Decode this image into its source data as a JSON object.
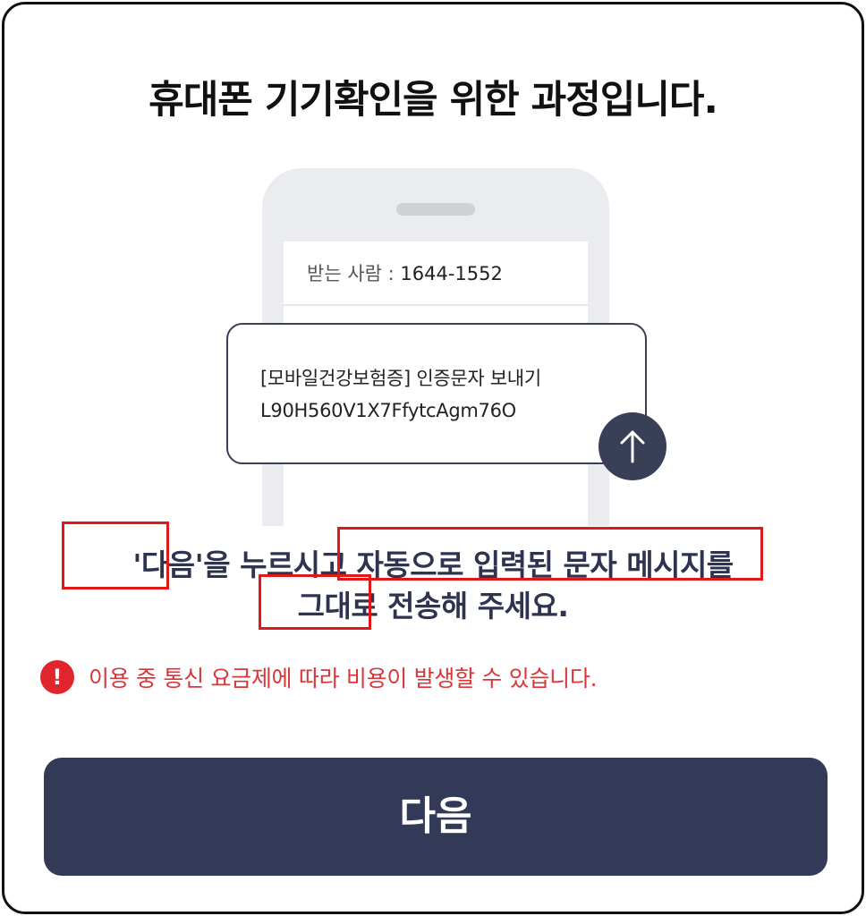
{
  "title": "휴대폰 기기확인을 위한 과정입니다.",
  "phone": {
    "recipient_label": "받는 사람 : ",
    "recipient_number": "1644-1552"
  },
  "message": {
    "line1": "[모바일건강보험증] 인증문자 보내기",
    "line2": "L90H560V1X7FfytcAgm76O"
  },
  "send_icon": "arrow-up-icon",
  "instruction": {
    "line1": "'다음'을 누르시고 자동으로 입력된 문자 메시지를",
    "line2": "그대로 전송해 주세요."
  },
  "warning": {
    "icon": "exclamation-icon",
    "icon_glyph": "!",
    "text": "이용 중 통신 요금제에 따라 비용이 발생할 수 있습니다."
  },
  "next_button": {
    "label": "다음"
  },
  "colors": {
    "primary": "#323a58",
    "warning": "#e0262c",
    "highlight": "#e01818"
  }
}
